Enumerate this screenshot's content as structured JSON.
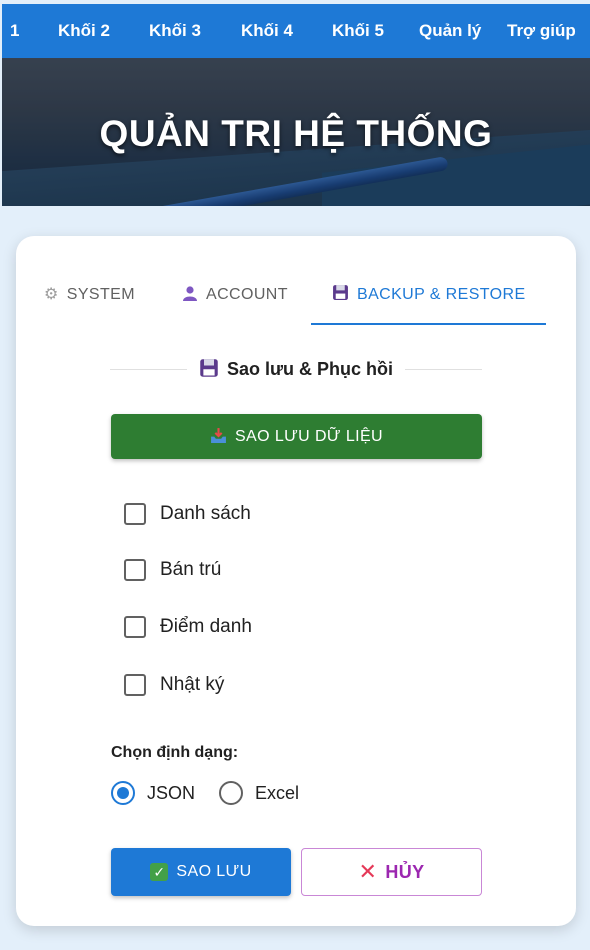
{
  "nav": {
    "items": [
      "1",
      "Khối 2",
      "Khối 3",
      "Khối 4",
      "Khối 5",
      "Quản lý",
      "Trợ giúp"
    ]
  },
  "hero": {
    "title": "QUẢN TRỊ HỆ THỐNG"
  },
  "tabs": [
    {
      "label": "SYSTEM",
      "icon": "gear-icon",
      "active": false
    },
    {
      "label": "ACCOUNT",
      "icon": "user-icon",
      "active": false
    },
    {
      "label": "BACKUP & RESTORE",
      "icon": "floppy-disk-icon",
      "active": true
    }
  ],
  "section": {
    "title": "Sao lưu & Phục hồi",
    "icon": "floppy-disk-icon"
  },
  "backup_button": {
    "label": "SAO LƯU DỮ LIỆU",
    "icon": "inbox-tray-icon"
  },
  "checkboxes": [
    {
      "label": "Danh sách",
      "checked": false
    },
    {
      "label": "Bán trú",
      "checked": false
    },
    {
      "label": "Điểm danh",
      "checked": false
    },
    {
      "label": "Nhật ký",
      "checked": false
    }
  ],
  "format": {
    "label": "Chọn định dạng:",
    "options": [
      {
        "label": "JSON",
        "selected": true
      },
      {
        "label": "Excel",
        "selected": false
      }
    ]
  },
  "actions": {
    "save_label": "SAO LƯU",
    "cancel_label": "HỦY"
  },
  "colors": {
    "primary": "#1e79d6",
    "success": "#2e7d32",
    "cancel": "#9c27b0",
    "background": "#e3effa"
  }
}
